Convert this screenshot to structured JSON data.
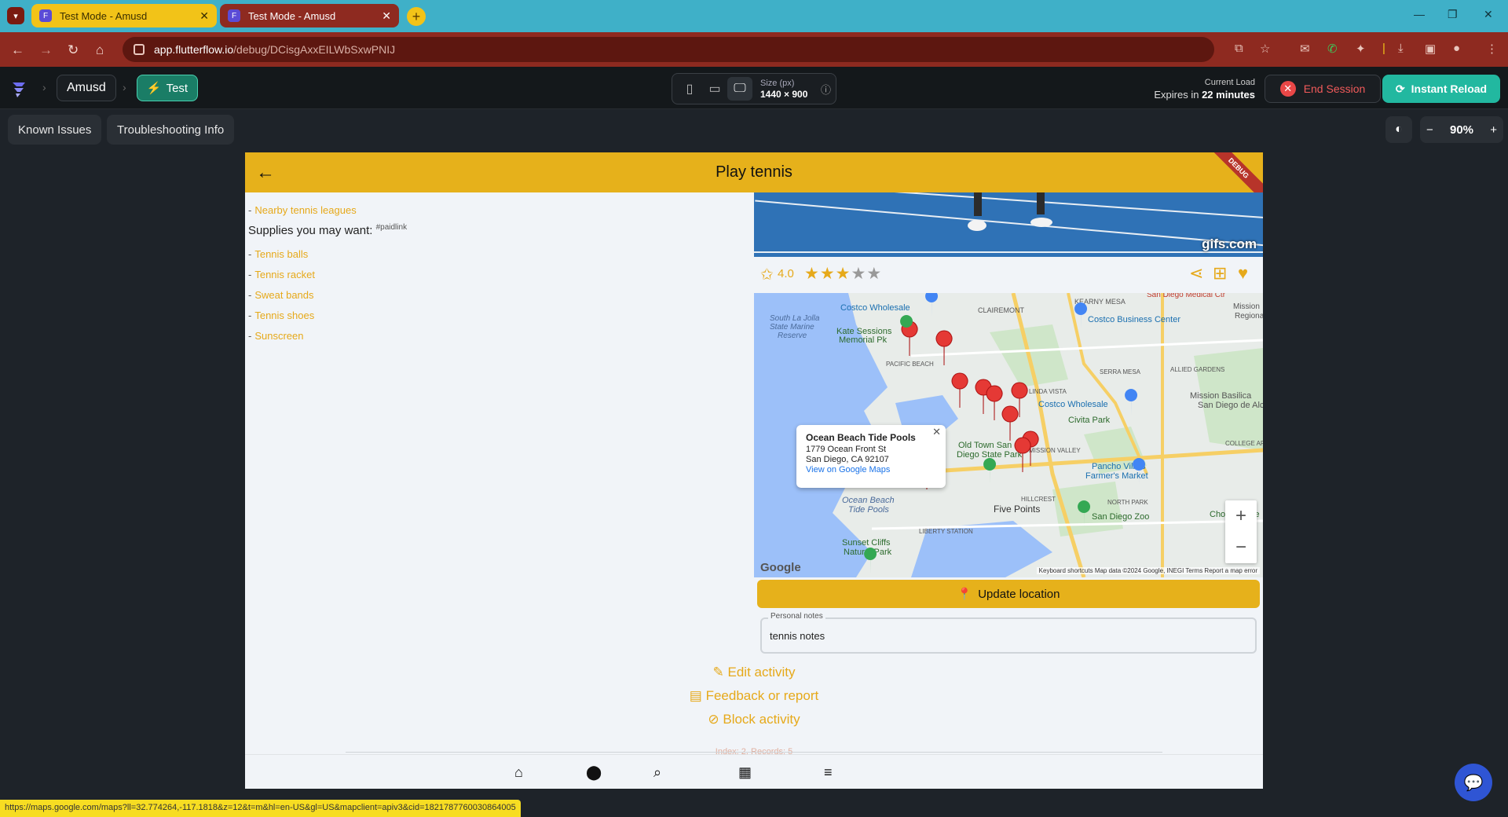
{
  "browser": {
    "tabs": [
      {
        "title": "Test Mode - Amusd",
        "active": false
      },
      {
        "title": "Test Mode - Amusd",
        "active": true
      }
    ],
    "url_host": "app.flutterflow.io",
    "url_path": "/debug/DCisgAxxEILWbSxwPNIJ",
    "status_url": "https://maps.google.com/maps?ll=32.774264,-117.1818&z=12&t=m&hl=en-US&gl=US&mapclient=apiv3&cid=1821787760030864005"
  },
  "toolbar": {
    "project": "Amusd",
    "mode": "Test",
    "size_label": "Size (px)",
    "size_value": "1440 × 900",
    "current_load_label": "Current Load",
    "expires_prefix": "Expires in",
    "expires_value": "22 minutes",
    "end_session": "End Session",
    "instant_reload": "Instant Reload",
    "known_issues": "Known Issues",
    "troubleshooting": "Troubleshooting Info",
    "zoom": "90%"
  },
  "app": {
    "title": "Play tennis",
    "debug_banner": "DEBUG",
    "leagues_link": "Nearby tennis leagues",
    "supplies_heading": "Supplies you may want:",
    "supplies_tag": "#paidlink",
    "supplies": [
      "Tennis balls",
      "Tennis racket",
      "Sweat bands",
      "Tennis shoes",
      "Sunscreen"
    ],
    "gif_watermark": "gifs.com",
    "rating": "4.0",
    "rating_value": 3,
    "rating_max": 5,
    "map": {
      "info_title": "Ocean Beach Tide Pools",
      "info_line1": "1779 Ocean Front St",
      "info_line2": "San Diego, CA 92107",
      "info_link": "View on Google Maps",
      "google": "Google",
      "attribution": "Keyboard shortcuts   Map data ©2024 Google, INEGI   Terms   Report a map error",
      "labels": [
        "Costco Wholesale",
        "Kate Sessions Memorial Pk",
        "CLAIREMONT",
        "KEARNY MESA",
        "Costco Business Center",
        "South La Jolla State Marine Reserve",
        "PACIFIC BEACH",
        "SERRA MESA",
        "ALLIED GARDENS",
        "LINDA VISTA",
        "Costco Wholesale",
        "Mission Basilica San Diego de Alcala",
        "Civita Park",
        "Old Town San Diego State Park",
        "MISSION VALLEY",
        "COLLEGE AREA",
        "Pancho Villa's Farmer's Market",
        "Ocean Beach Tide Pools",
        "HILLCREST",
        "NORTH PARK",
        "Five Points",
        "San Diego Zoo",
        "Chollas Lake",
        "LIBERTY STATION",
        "Sunset Cliffs Natural Park",
        "San Diego Medical Ctr",
        "Mission Regional"
      ]
    },
    "update_location": "Update location",
    "notes_label": "Personal notes",
    "notes_value": "tennis notes",
    "edit_activity": "Edit activity",
    "feedback": "Feedback or report",
    "block": "Block activity",
    "index_text": "Index: 2, Records: 5"
  },
  "colors": {
    "accent": "#e6b11b",
    "link": "#e6a91a",
    "tab_active": "#8e2a20",
    "tabbar": "#3fb0c8"
  }
}
